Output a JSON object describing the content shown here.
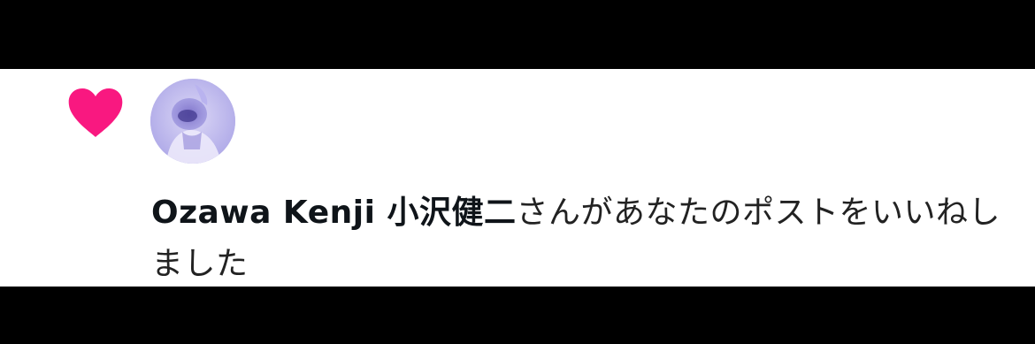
{
  "notification": {
    "type_icon": "heart-icon",
    "accent_color": "#f91880",
    "avatar_icon": "avatar",
    "actor_name": "Ozawa Kenji 小沢健二",
    "action_text": "さんがあなたのポストをいいねしました"
  }
}
